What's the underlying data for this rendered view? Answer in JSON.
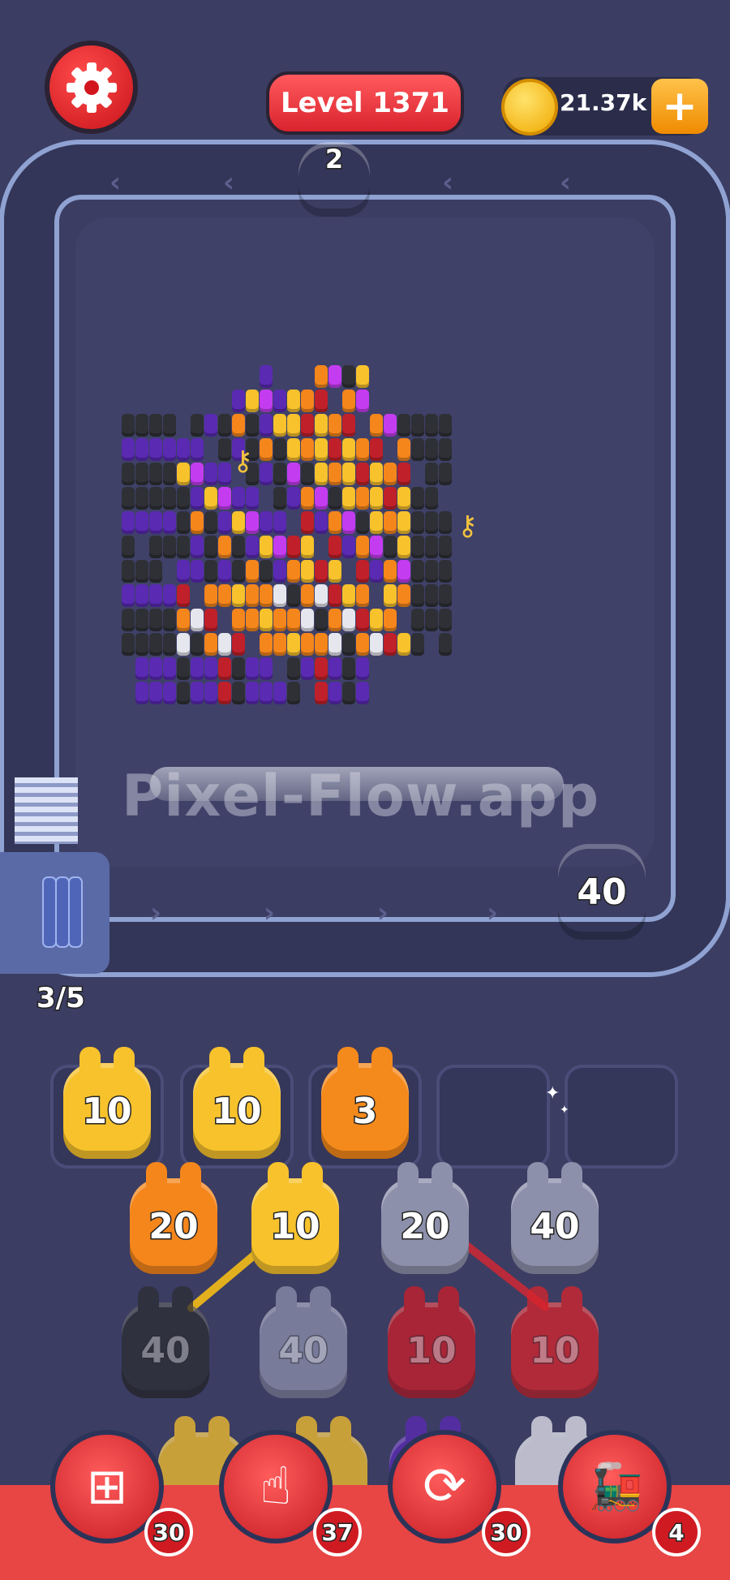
{
  "header": {
    "level_label": "Level 1371",
    "coins": "21.37k",
    "add_coins_symbol": "+"
  },
  "conveyor": {
    "top_character": {
      "count": "2",
      "color": "#f7c82f"
    },
    "side_character": {
      "count": "40",
      "color": "#5b2ab5"
    },
    "capacity_label": "3/5",
    "watermark": "Pixel-Flow.app"
  },
  "slots": [
    {
      "count": "10",
      "color": "#f7c22c"
    },
    {
      "count": "10",
      "color": "#f7c22c"
    },
    {
      "count": "3",
      "color": "#f58a1c"
    },
    {
      "count": "",
      "color": ""
    },
    {
      "count": "",
      "color": ""
    }
  ],
  "queue": [
    {
      "count": "20",
      "color": "#f5861c",
      "active": true
    },
    {
      "count": "10",
      "color": "#f7c22c",
      "active": true
    },
    {
      "count": "20",
      "color": "#8d90ab",
      "active": true
    },
    {
      "count": "40",
      "color": "#8d90ab",
      "active": true
    },
    {
      "count": "40",
      "color": "#2d2d33",
      "active": false
    },
    {
      "count": "40",
      "color": "#8d90ab",
      "active": false
    },
    {
      "count": "10",
      "color": "#cc1d27",
      "active": false
    },
    {
      "count": "10",
      "color": "#d8242b",
      "active": false
    }
  ],
  "powerups": [
    {
      "name": "add-slot",
      "count": "30"
    },
    {
      "name": "tap",
      "count": "37"
    },
    {
      "name": "shuffle",
      "count": "30"
    },
    {
      "name": "train",
      "count": "4"
    }
  ],
  "palette": {
    "orange": "#f5861c",
    "yellow": "#f7c22c",
    "purple": "#5a2ab3",
    "magenta": "#c43cf0",
    "dark": "#2f3036",
    "red": "#c0202a",
    "white": "#e6e6ee",
    "black": "#1e1f24"
  }
}
